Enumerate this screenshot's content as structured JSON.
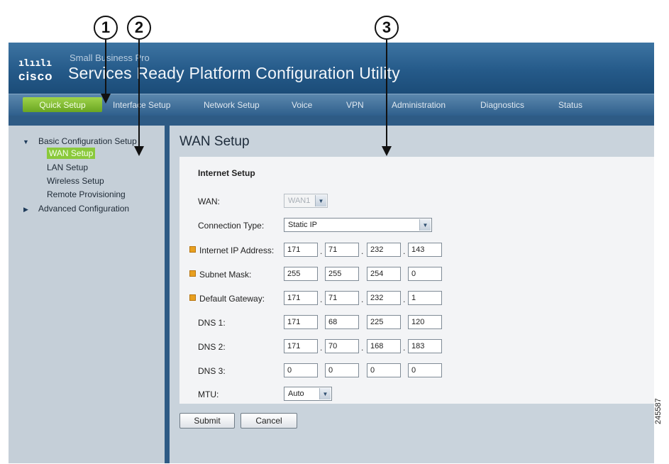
{
  "callouts": [
    "1",
    "2",
    "3"
  ],
  "header": {
    "logo_bars": "ılıılı",
    "logo_word": "cisco",
    "product_line": "Small Business Pro",
    "title": "Services Ready Platform Configuration Utility"
  },
  "nav": {
    "active": "Quick Setup",
    "items": [
      "Interface Setup",
      "Network Setup",
      "Voice",
      "VPN",
      "Administration",
      "Diagnostics",
      "Status"
    ]
  },
  "sidebar": {
    "group1": "Basic Configuration Setup",
    "items": [
      "WAN Setup",
      "LAN Setup",
      "Wireless Setup",
      "Remote Provisioning"
    ],
    "group2": "Advanced Configuration"
  },
  "content": {
    "page_title": "WAN Setup",
    "section_title": "Internet Setup",
    "wan": {
      "label": "WAN:",
      "value": "WAN1"
    },
    "connection_type": {
      "label": "Connection Type:",
      "value": "Static IP"
    },
    "internet_ip": {
      "label": "Internet IP Address:",
      "octets": [
        "171",
        "71",
        "232",
        "143"
      ]
    },
    "subnet_mask": {
      "label": "Subnet Mask:",
      "octets": [
        "255",
        "255",
        "254",
        "0"
      ]
    },
    "default_gateway": {
      "label": "Default Gateway:",
      "octets": [
        "171",
        "71",
        "232",
        "1"
      ]
    },
    "dns1": {
      "label": "DNS 1:",
      "octets": [
        "171",
        "68",
        "225",
        "120"
      ]
    },
    "dns2": {
      "label": "DNS 2:",
      "octets": [
        "171",
        "70",
        "168",
        "183"
      ]
    },
    "dns3": {
      "label": "DNS 3:",
      "octets": [
        "0",
        "0",
        "0",
        "0"
      ]
    },
    "mtu": {
      "label": "MTU:",
      "value": "Auto"
    },
    "submit_label": "Submit",
    "cancel_label": "Cancel"
  },
  "figure_id": "245587",
  "colors": {
    "banner": "#255a89",
    "active_green": "#8ac93b",
    "required": "#e8a020",
    "panel": "#f3f4f6"
  }
}
